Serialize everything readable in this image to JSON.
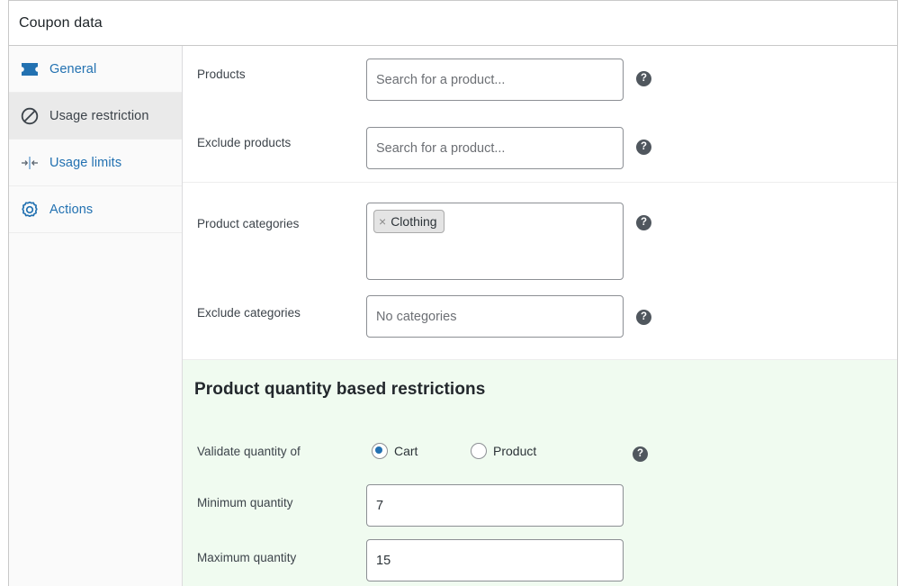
{
  "panel": {
    "title": "Coupon data"
  },
  "sidebar": {
    "items": [
      {
        "label": "General",
        "icon": "ticket-icon",
        "active": false
      },
      {
        "label": "Usage restriction",
        "icon": "prohibition-icon",
        "active": true
      },
      {
        "label": "Usage limits",
        "icon": "align-center-icon",
        "active": false
      },
      {
        "label": "Actions",
        "icon": "gear-icon",
        "active": false
      }
    ]
  },
  "form": {
    "help_label": "?",
    "rows": [
      {
        "label": "Products",
        "placeholder": "Search for a product...",
        "value": ""
      },
      {
        "label": "Exclude products",
        "placeholder": "Search for a product...",
        "value": ""
      },
      {
        "label": "Product categories",
        "tags": [
          "Clothing"
        ],
        "remove_glyph": "×"
      },
      {
        "label": "Exclude categories",
        "placeholder": "No categories",
        "value": ""
      }
    ]
  },
  "quantity_section": {
    "title": "Product quantity based restrictions",
    "validate_label": "Validate quantity of",
    "options": [
      {
        "label": "Cart",
        "selected": true
      },
      {
        "label": "Product",
        "selected": false
      }
    ],
    "min_label": "Minimum quantity",
    "min_value": "7",
    "max_label": "Maximum quantity",
    "max_value": "15",
    "bg_color": "#f0fbf0"
  },
  "colors": {
    "accent_blue": "#2271b1",
    "help_bg": "#50575e",
    "active_item_bg": "#eaeaea",
    "sidebar_bg": "#fafafa"
  }
}
